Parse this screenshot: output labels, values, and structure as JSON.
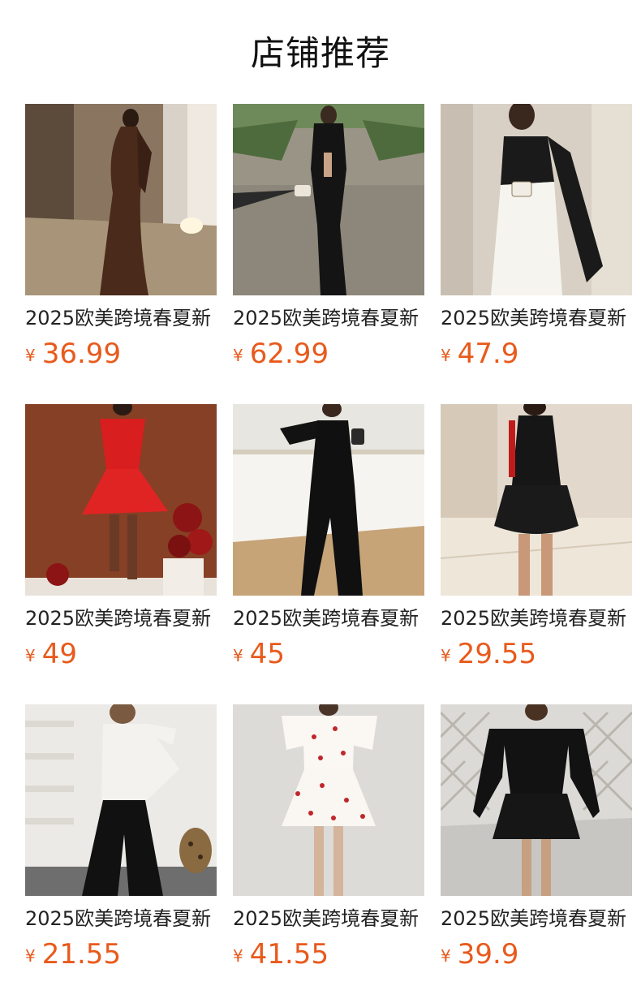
{
  "section": {
    "title": "店铺推荐"
  },
  "colors": {
    "price": "#e85a1c",
    "title_text": "#222222",
    "heading_text": "#111111"
  },
  "products": [
    {
      "title": "2025欧美跨境春夏新",
      "currency": "¥",
      "price": "36.99",
      "image": "brown-maxi-dress-photo"
    },
    {
      "title": "2025欧美跨境春夏新",
      "currency": "¥",
      "price": "62.99",
      "image": "black-cutout-dress-photo"
    },
    {
      "title": "2025欧美跨境春夏新",
      "currency": "¥",
      "price": "47.9",
      "image": "black-white-skirt-set-photo"
    },
    {
      "title": "2025欧美跨境春夏新",
      "currency": "¥",
      "price": "49",
      "image": "red-mini-dress-photo"
    },
    {
      "title": "2025欧美跨境春夏新",
      "currency": "¥",
      "price": "45",
      "image": "black-ruffle-dress-photo"
    },
    {
      "title": "2025欧美跨境春夏新",
      "currency": "¥",
      "price": "29.55",
      "image": "black-bubble-dress-photo"
    },
    {
      "title": "2025欧美跨境春夏新",
      "currency": "¥",
      "price": "21.55",
      "image": "white-top-flare-pants-photo"
    },
    {
      "title": "2025欧美跨境春夏新",
      "currency": "¥",
      "price": "41.55",
      "image": "cherry-print-dress-photo"
    },
    {
      "title": "2025欧美跨境春夏新",
      "currency": "¥",
      "price": "39.9",
      "image": "black-offshoulder-dress-photo"
    }
  ]
}
